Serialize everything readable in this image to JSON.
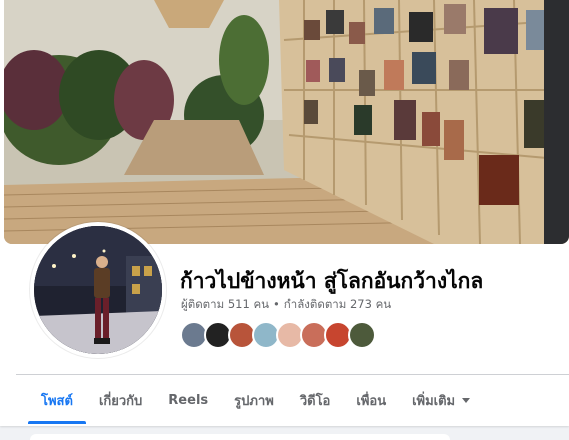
{
  "profile": {
    "name": "ก้าวไปข้างหน้า สู่โลกอันกว้างไกล",
    "followers": "ผู้ติดตาม 511 คน",
    "separator": "•",
    "following": "กำลังติดตาม 273 คน"
  },
  "tabs": [
    {
      "label": "โพสต์",
      "active": true
    },
    {
      "label": "เกี่ยวกับ",
      "active": false
    },
    {
      "label": "Reels",
      "active": false
    },
    {
      "label": "รูปภาพ",
      "active": false
    },
    {
      "label": "วิดีโอ",
      "active": false
    },
    {
      "label": "เพื่อน",
      "active": false
    },
    {
      "label": "เพิ่มเติม",
      "active": false
    }
  ],
  "mutual_followers": [
    {
      "icon": "follower-avatar-icon",
      "color": "#6b7a8f"
    },
    {
      "icon": "follower-avatar-icon",
      "color": "#222222"
    },
    {
      "icon": "follower-avatar-icon",
      "color": "#b8543a"
    },
    {
      "icon": "follower-avatar-icon",
      "color": "#8fb7c9"
    },
    {
      "icon": "follower-avatar-icon",
      "color": "#e7b9a6"
    },
    {
      "icon": "follower-avatar-icon",
      "color": "#c96e5a"
    },
    {
      "icon": "follower-avatar-icon",
      "color": "#c7452f"
    },
    {
      "icon": "follower-avatar-icon",
      "color": "#4d5a3b"
    }
  ],
  "colors": {
    "accent": "#1877f2",
    "text_primary": "#050505",
    "text_secondary": "#65676b",
    "page_bg": "#f0f2f5"
  }
}
